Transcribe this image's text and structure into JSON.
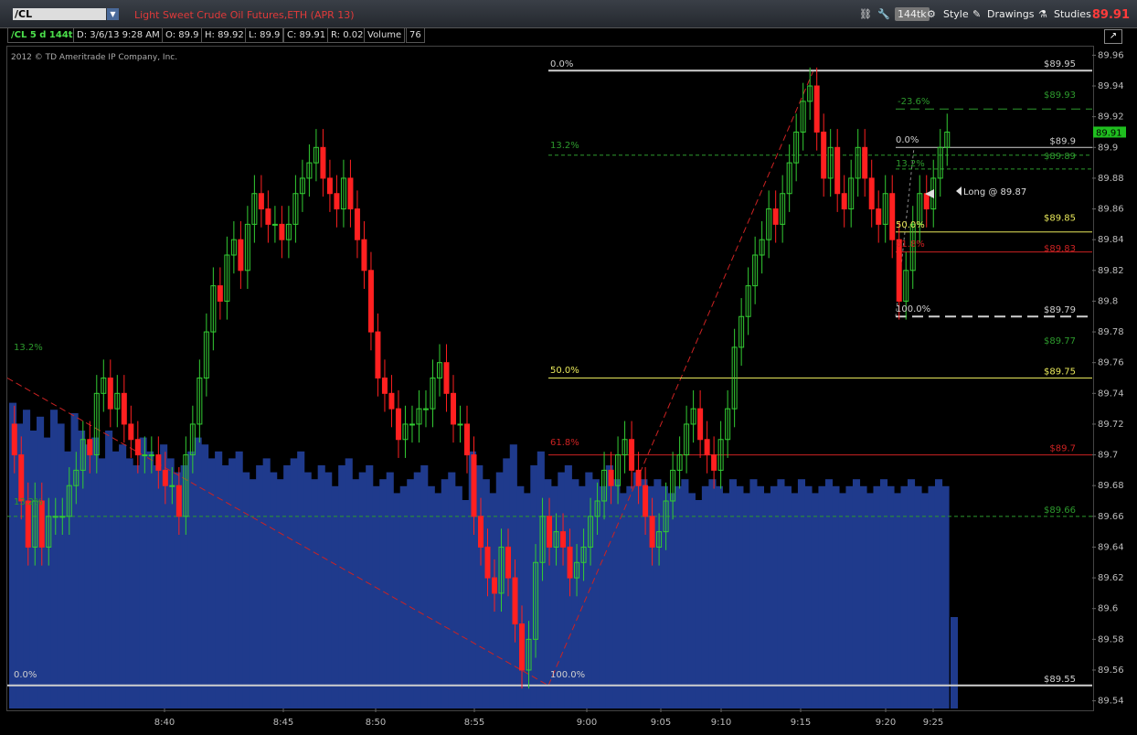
{
  "toolbar": {
    "symbol": "/CL",
    "description": "Light Sweet Crude Oil Futures,ETH (APR 13)",
    "tick_label": "144tk",
    "style_label": "Style",
    "drawings_label": "Drawings",
    "studies_label": "Studies",
    "last_price": "89.91"
  },
  "info": {
    "spec": "/CL 5 d 144t",
    "date": "D: 3/6/13 9:28 AM",
    "open": "O: 89.9",
    "high": "H: 89.92",
    "low": "L: 89.9",
    "close": "C: 89.91",
    "range": "R: 0.02",
    "volume_label": "Volume",
    "volume_value": "76"
  },
  "copyright": "2012 © TD Ameritrade IP Company, Inc.",
  "colors": {
    "up": "#33cc33",
    "down": "#ff2020",
    "volume": "#1f3a8c",
    "fib_white": "#cfcfcf",
    "fib_yellow": "#e8e85a",
    "fib_red": "#cc2222",
    "fib_green": "#2d9a2d"
  },
  "chart_data": {
    "type": "candlestick",
    "y_ticks": [
      "89.96",
      "89.94",
      "89.92",
      "89.9",
      "89.88",
      "89.86",
      "89.84",
      "89.82",
      "89.8",
      "89.78",
      "89.76",
      "89.74",
      "89.72",
      "89.7",
      "89.68",
      "89.66",
      "89.64",
      "89.62",
      "89.6",
      "89.58",
      "89.56",
      "89.54"
    ],
    "ylim": [
      89.535,
      89.965
    ],
    "x_labels": [
      "8:40",
      "8:45",
      "8:50",
      "8:55",
      "9:00",
      "9:05",
      "9:10",
      "9:15",
      "9:20",
      "9:25"
    ],
    "current_price": "89.91",
    "fib_labels": [
      {
        "text": "0.0%",
        "color": "white"
      },
      {
        "text": "13.2%",
        "color": "green"
      },
      {
        "text": "50.0%",
        "color": "yellow"
      },
      {
        "text": "61.8%",
        "color": "red"
      },
      {
        "text": "13.2%",
        "color": "green"
      },
      {
        "text": "0.0%",
        "color": "white"
      },
      {
        "text": "100.0%",
        "color": "white"
      },
      {
        "text": "-23.6%",
        "color": "green"
      },
      {
        "text": "0.0%",
        "color": "white"
      },
      {
        "text": "13.2%",
        "color": "green"
      },
      {
        "text": "50.0%",
        "color": "yellow"
      },
      {
        "text": "61.8%",
        "color": "red"
      },
      {
        "text": "100.0%",
        "color": "white"
      }
    ],
    "price_labels": [
      {
        "text": "$89.95",
        "price": 89.95,
        "color": "white"
      },
      {
        "text": "$89.93",
        "price": 89.93,
        "color": "green"
      },
      {
        "text": "$89.9",
        "price": 89.9,
        "color": "white"
      },
      {
        "text": "$89.89",
        "price": 89.89,
        "color": "green"
      },
      {
        "text": "$89.85",
        "price": 89.85,
        "color": "yellow"
      },
      {
        "text": "$89.83",
        "price": 89.83,
        "color": "red"
      },
      {
        "text": "$89.79",
        "price": 89.79,
        "color": "white"
      },
      {
        "text": "$89.77",
        "price": 89.77,
        "color": "green"
      },
      {
        "text": "$89.75",
        "price": 89.75,
        "color": "yellow"
      },
      {
        "text": "$89.7",
        "price": 89.7,
        "color": "red"
      },
      {
        "text": "$89.66",
        "price": 89.66,
        "color": "green"
      },
      {
        "text": "$89.55",
        "price": 89.55,
        "color": "white"
      }
    ],
    "annotation": "Long @ 89.87",
    "closes": [
      89.7,
      89.67,
      89.64,
      89.67,
      89.64,
      89.66,
      89.66,
      89.66,
      89.68,
      89.69,
      89.71,
      89.7,
      89.74,
      89.75,
      89.73,
      89.74,
      89.72,
      89.71,
      89.7,
      89.7,
      89.7,
      89.69,
      89.68,
      89.68,
      89.66,
      89.7,
      89.72,
      89.75,
      89.78,
      89.81,
      89.8,
      89.83,
      89.84,
      89.82,
      89.85,
      89.87,
      89.86,
      89.85,
      89.85,
      89.84,
      89.85,
      89.87,
      89.88,
      89.89,
      89.9,
      89.88,
      89.87,
      89.86,
      89.88,
      89.86,
      89.84,
      89.82,
      89.78,
      89.75,
      89.74,
      89.73,
      89.71,
      89.72,
      89.72,
      89.73,
      89.73,
      89.75,
      89.76,
      89.74,
      89.72,
      89.72,
      89.7,
      89.66,
      89.64,
      89.62,
      89.61,
      89.64,
      89.62,
      89.59,
      89.56,
      89.58,
      89.63,
      89.66,
      89.64,
      89.65,
      89.64,
      89.62,
      89.63,
      89.64,
      89.66,
      89.67,
      89.69,
      89.68,
      89.7,
      89.71,
      89.69,
      89.68,
      89.66,
      89.64,
      89.65,
      89.67,
      89.69,
      89.7,
      89.72,
      89.73,
      89.71,
      89.7,
      89.69,
      89.71,
      89.73,
      89.77,
      89.79,
      89.81,
      89.83,
      89.84,
      89.86,
      89.85,
      89.87,
      89.89,
      89.91,
      89.93,
      89.94,
      89.91,
      89.88,
      89.9,
      89.87,
      89.86,
      89.88,
      89.9,
      89.88,
      89.86,
      89.85,
      89.87,
      89.84,
      89.8,
      89.82,
      89.85,
      89.87,
      89.86,
      89.88,
      89.9,
      89.91
    ],
    "volumes": [
      88,
      82,
      86,
      80,
      84,
      78,
      86,
      82,
      74,
      85,
      80,
      76,
      78,
      72,
      80,
      74,
      76,
      72,
      70,
      78,
      74,
      70,
      76,
      72,
      68,
      70,
      74,
      78,
      76,
      72,
      74,
      70,
      72,
      74,
      68,
      66,
      70,
      72,
      68,
      66,
      70,
      72,
      74,
      68,
      66,
      70,
      68,
      64,
      70,
      72,
      66,
      68,
      70,
      64,
      66,
      68,
      62,
      64,
      66,
      68,
      70,
      64,
      62,
      66,
      68,
      64,
      60,
      74,
      70,
      66,
      62,
      68,
      72,
      76,
      64,
      62,
      70,
      74,
      66,
      64,
      68,
      70,
      66,
      64,
      68,
      66,
      64,
      70,
      66,
      62,
      64,
      68,
      66,
      64,
      66,
      64,
      62,
      64,
      66,
      62,
      60,
      64,
      66,
      64,
      62,
      66,
      64,
      62,
      66,
      64,
      62,
      64,
      66,
      64,
      62,
      66,
      64,
      62,
      64,
      66,
      64,
      62,
      64,
      66,
      64,
      62,
      64,
      66,
      64,
      62,
      64,
      66,
      64,
      62,
      64,
      66,
      64
    ]
  }
}
